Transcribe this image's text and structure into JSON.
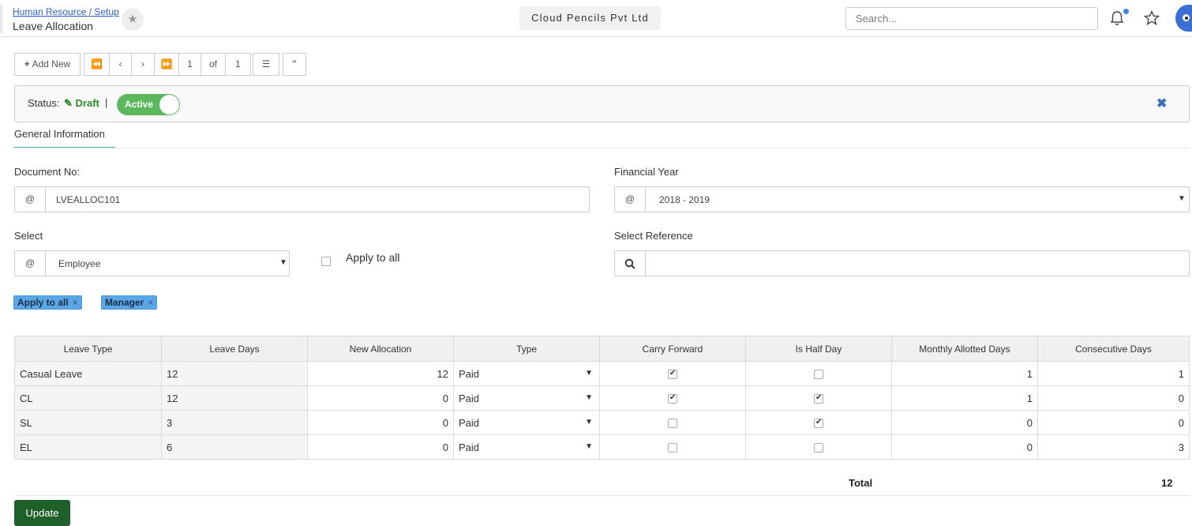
{
  "header": {
    "breadcrumb": "Human Resource / Setup",
    "title": "Leave Allocation",
    "company": "Cloud Pencils Pvt Ltd",
    "search_placeholder": "Search..."
  },
  "toolbar": {
    "add_new": "Add New",
    "page_current": "1",
    "page_of": "of",
    "page_total": "1"
  },
  "status": {
    "label": "Status:",
    "value": "Draft",
    "separator": "|",
    "toggle_label": "Active"
  },
  "tabs": [
    {
      "label": "General Information"
    }
  ],
  "form": {
    "document_no_label": "Document No:",
    "document_no_addon": "@",
    "document_no_value": "LVEALLOC101",
    "financial_year_label": "Financial Year",
    "financial_year_addon": "@",
    "financial_year_value": "2018 - 2019",
    "select_label": "Select",
    "select_addon": "@",
    "select_value": "Employee",
    "apply_to_all_label": "Apply to all",
    "select_reference_label": "Select Reference"
  },
  "tags": [
    {
      "label": "Apply to all",
      "remove": "×"
    },
    {
      "label": "Manager",
      "remove": "×"
    }
  ],
  "table": {
    "columns": [
      "Leave Type",
      "Leave Days",
      "New Allocation",
      "Type",
      "Carry Forward",
      "Is Half Day",
      "Monthly Allotted Days",
      "Consecutive Days"
    ],
    "rows": [
      {
        "leave_type": "Casual Leave",
        "leave_days": "12",
        "new_allocation": "12",
        "type": "Paid",
        "carry_forward": true,
        "is_half_day": false,
        "monthly_allotted": "1",
        "consecutive": "1"
      },
      {
        "leave_type": "CL",
        "leave_days": "12",
        "new_allocation": "0",
        "type": "Paid",
        "carry_forward": true,
        "is_half_day": true,
        "monthly_allotted": "1",
        "consecutive": "0"
      },
      {
        "leave_type": "SL",
        "leave_days": "3",
        "new_allocation": "0",
        "type": "Paid",
        "carry_forward": false,
        "is_half_day": true,
        "monthly_allotted": "0",
        "consecutive": "0"
      },
      {
        "leave_type": "EL",
        "leave_days": "6",
        "new_allocation": "0",
        "type": "Paid",
        "carry_forward": false,
        "is_half_day": false,
        "monthly_allotted": "0",
        "consecutive": "3"
      }
    ]
  },
  "total": {
    "label": "Total",
    "value": "12"
  },
  "actions": {
    "update": "Update"
  },
  "colors": {
    "accent": "#5cb85c",
    "update_button": "#1e5f2a",
    "tag": "#5ba7e6",
    "tab_underline": "#4fb0a5",
    "link": "#2a62c9"
  },
  "icons": [
    "star-icon",
    "bell-icon",
    "star-outline-icon",
    "plus-icon",
    "first-page-icon",
    "prev-page-icon",
    "next-page-icon",
    "last-page-icon",
    "list-icon",
    "collapse-up-icon",
    "pencil-icon",
    "close-icon",
    "search-icon",
    "chevron-down-icon"
  ]
}
